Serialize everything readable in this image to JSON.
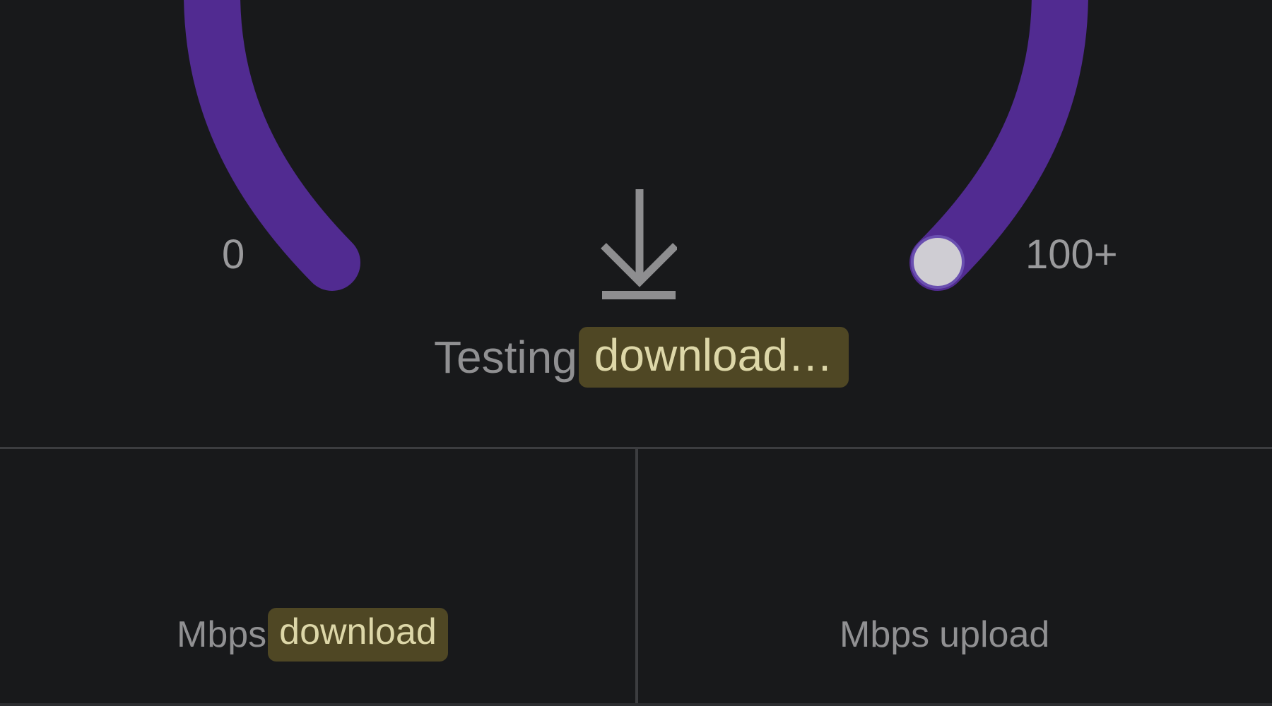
{
  "gauge": {
    "min_label": "0",
    "max_label": "100+",
    "progress": 1.0,
    "arc_color": "#512b91",
    "knob_color": "#cfcdd3",
    "track_color": "#512b91"
  },
  "icon": {
    "name": "download-arrow-icon",
    "color": "#8e8e90"
  },
  "status": {
    "prefix": "Testing",
    "highlight": "download…"
  },
  "results": {
    "download": {
      "unit": "Mbps",
      "label": "download"
    },
    "upload": {
      "unit": "Mbps",
      "label": "upload"
    }
  },
  "colors": {
    "background": "#18191b",
    "highlight_bg": "#4f4724",
    "highlight_text": "#ddd7a8",
    "text": "#909092"
  }
}
